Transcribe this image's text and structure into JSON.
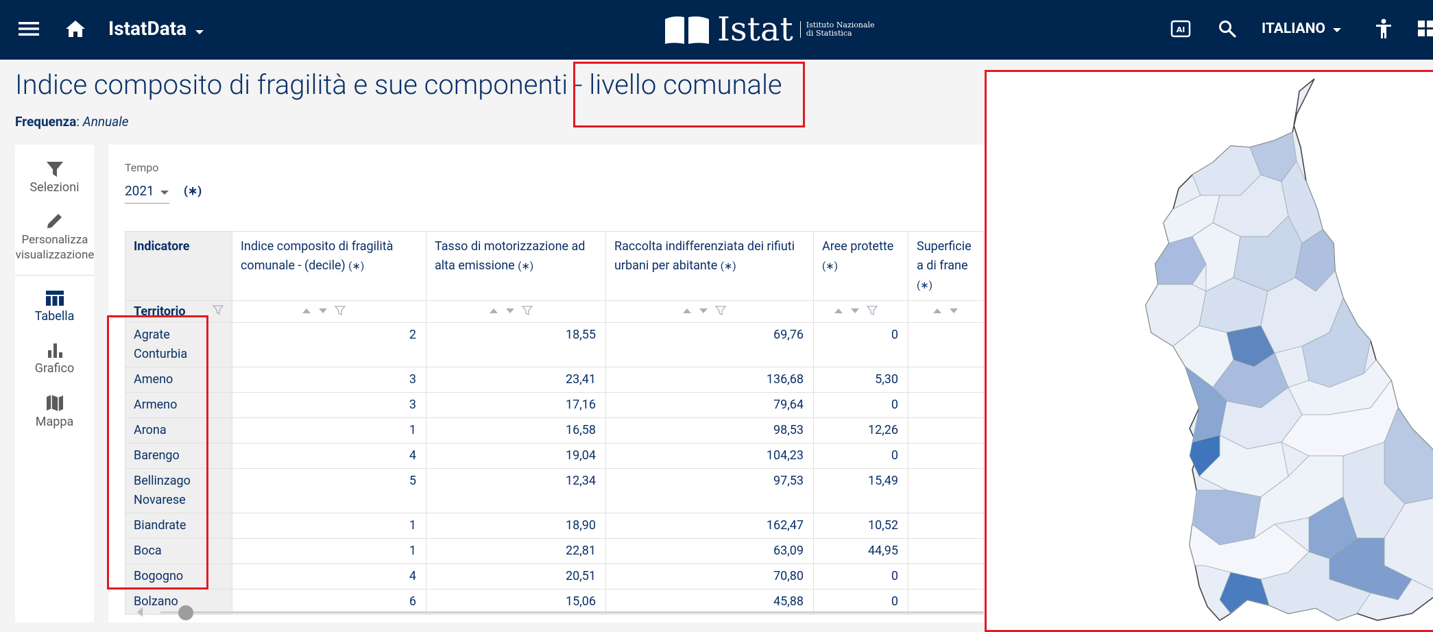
{
  "topbar": {
    "app_name": "IstatData",
    "logo_text": "Istat",
    "logo_subtitle_1": "Istituto Nazionale",
    "logo_subtitle_2": "di Statistica",
    "language": "ITALIANO",
    "bg_color": "#00254f"
  },
  "page": {
    "title": "Indice composito di fragilità e sue componenti - livello comunale",
    "frequency_label": "Frequenza",
    "frequency_value": "Annuale"
  },
  "sidebar": {
    "items": [
      {
        "label": "Selezioni",
        "icon": "filter-icon"
      },
      {
        "label": "Personalizza visualizzazione",
        "icon": "pencil-icon"
      },
      {
        "label": "Tabella",
        "icon": "table-icon"
      },
      {
        "label": "Grafico",
        "icon": "bar-chart-icon"
      },
      {
        "label": "Mappa",
        "icon": "map-icon"
      }
    ]
  },
  "filter": {
    "label": "Tempo",
    "value": "2021",
    "marker": "(∗)"
  },
  "table": {
    "row_header": "Indicatore",
    "territory_header": "Territorio",
    "columns": [
      "Indice composito di fragilità comunale - (decile)",
      "Tasso di motorizzazione ad alta emissione",
      "Raccolta indifferenziata dei rifiuti urbani per abitante",
      "Aree protette",
      "Superficie a di frane"
    ],
    "column_marker": "(∗)",
    "rows": [
      {
        "territorio": "Agrate Conturbia",
        "values": [
          "2",
          "18,55",
          "69,76",
          "0",
          ""
        ]
      },
      {
        "territorio": "Ameno",
        "values": [
          "3",
          "23,41",
          "136,68",
          "5,30",
          ""
        ]
      },
      {
        "territorio": "Armeno",
        "values": [
          "3",
          "17,16",
          "79,64",
          "0",
          ""
        ]
      },
      {
        "territorio": "Arona",
        "values": [
          "1",
          "16,58",
          "98,53",
          "12,26",
          ""
        ]
      },
      {
        "territorio": "Barengo",
        "values": [
          "4",
          "19,04",
          "104,23",
          "0",
          ""
        ]
      },
      {
        "territorio": "Bellinzago Novarese",
        "values": [
          "5",
          "12,34",
          "97,53",
          "15,49",
          ""
        ]
      },
      {
        "territorio": "Biandrate",
        "values": [
          "1",
          "18,90",
          "162,47",
          "10,52",
          ""
        ]
      },
      {
        "territorio": "Boca",
        "values": [
          "1",
          "22,81",
          "63,09",
          "44,95",
          ""
        ]
      },
      {
        "territorio": "Bogogno",
        "values": [
          "4",
          "20,51",
          "70,80",
          "0",
          ""
        ]
      },
      {
        "territorio": "Bolzano",
        "values": [
          "6",
          "15,06",
          "45,88",
          "0",
          ""
        ]
      }
    ]
  },
  "colors": {
    "accent_red": "#e3191f",
    "text_navy": "#0a3068"
  }
}
